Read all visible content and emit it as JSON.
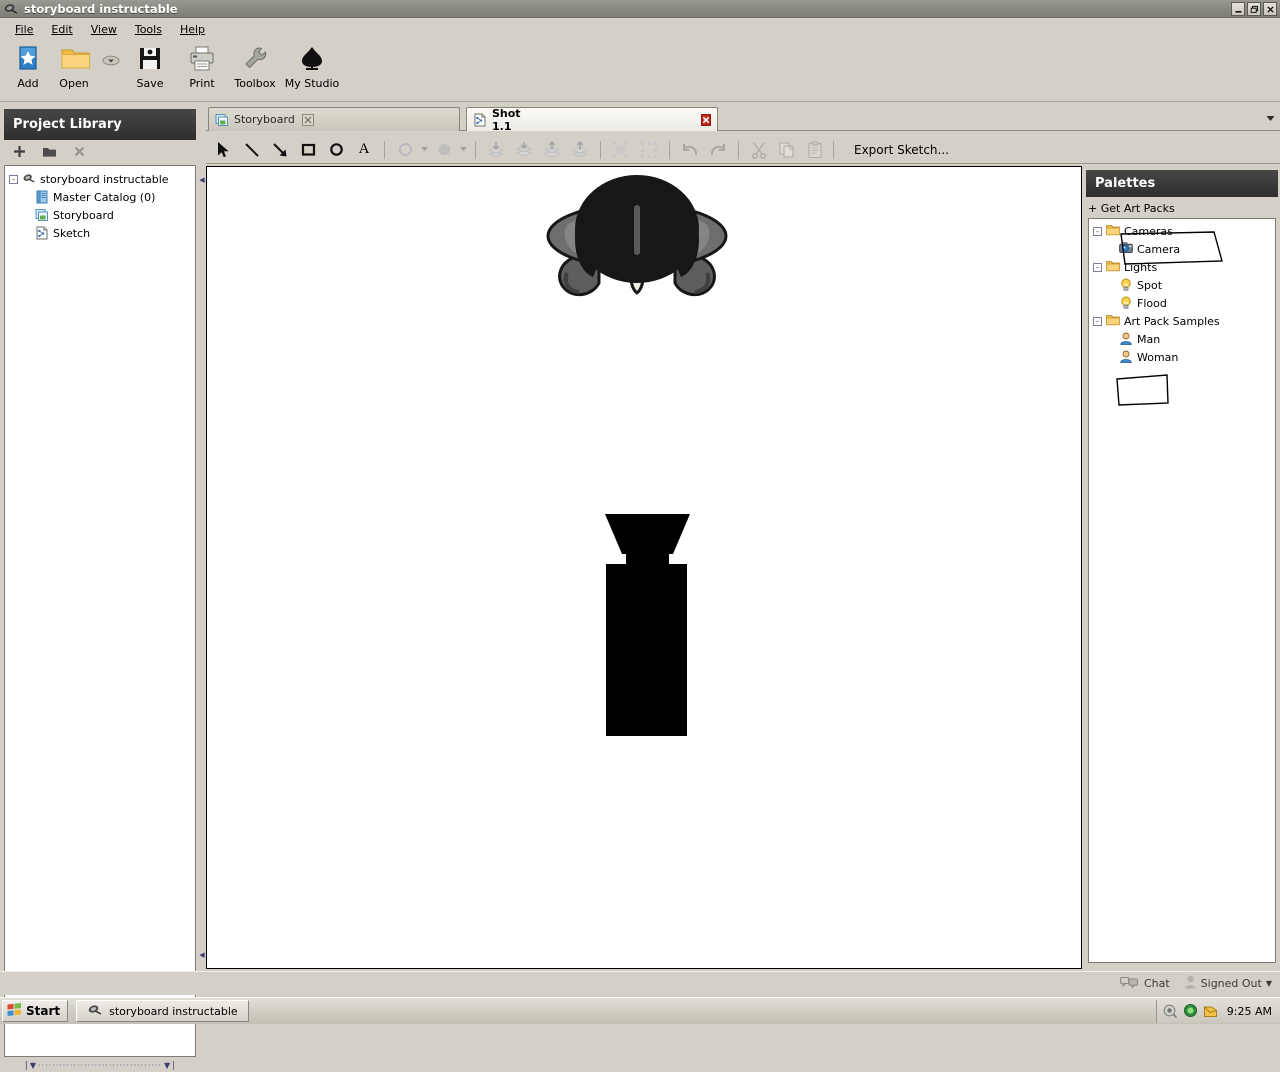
{
  "window": {
    "title": "storyboard instructable",
    "icon": "app-logo-icon",
    "minimize": "_",
    "maximize": "❐",
    "close": "✕"
  },
  "menu": [
    {
      "label": "File",
      "accel": "F"
    },
    {
      "label": "Edit",
      "accel": "E"
    },
    {
      "label": "View",
      "accel": "V"
    },
    {
      "label": "Tools",
      "accel": "T"
    },
    {
      "label": "Help",
      "accel": "H"
    }
  ],
  "toolbar": [
    {
      "label": "Add",
      "icon": "add-star-icon"
    },
    {
      "label": "Open",
      "icon": "open-folder-icon"
    },
    {
      "label": "Save",
      "icon": "save-floppy-icon"
    },
    {
      "label": "Print",
      "icon": "print-icon"
    },
    {
      "label": "Toolbox",
      "icon": "wrench-toolbox-icon"
    },
    {
      "label": "My Studio",
      "icon": "my-studio-icon"
    }
  ],
  "library": {
    "header": "Project Library",
    "tools": [
      {
        "name": "add-item-button",
        "glyph": "＋"
      },
      {
        "name": "new-folder-button",
        "glyph": "▬"
      },
      {
        "name": "delete-item-button",
        "glyph": "✕"
      }
    ],
    "tree": [
      {
        "label": "storyboard instructable",
        "icon": "project-icon",
        "depth": 0,
        "twisty": "-"
      },
      {
        "label": "Master Catalog (0)",
        "icon": "catalog-icon",
        "depth": 1,
        "twisty": ""
      },
      {
        "label": "Storyboard",
        "icon": "storyboard-icon",
        "depth": 1,
        "twisty": ""
      },
      {
        "label": "Sketch",
        "icon": "sketch-icon",
        "depth": 1,
        "twisty": ""
      }
    ]
  },
  "tabs": [
    {
      "label": "Storyboard",
      "icon": "storyboard-icon",
      "active": false,
      "close": "✕"
    },
    {
      "label": "Shot 1.1",
      "icon": "sketch-icon",
      "active": true,
      "close": "✕"
    }
  ],
  "tab_overflow": "▼",
  "doc_toolbar": {
    "tools": [
      {
        "name": "select-arrow-tool",
        "glyph": "➤",
        "enabled": true
      },
      {
        "name": "line-tool",
        "glyph": "╲",
        "enabled": true
      },
      {
        "name": "arrow-tool",
        "glyph": "↘",
        "enabled": true
      },
      {
        "name": "rectangle-tool",
        "glyph": "□",
        "enabled": true
      },
      {
        "name": "ellipse-tool",
        "glyph": "◯",
        "enabled": true
      },
      {
        "name": "text-tool",
        "glyph": "A",
        "enabled": true
      },
      {
        "name": "stroke-color-tool",
        "glyph": "◯",
        "enabled": false
      },
      {
        "name": "fill-color-tool",
        "glyph": "●",
        "enabled": false
      },
      {
        "name": "send-to-back-tool",
        "glyph": "⬇",
        "enabled": false
      },
      {
        "name": "send-backward-tool",
        "glyph": "⬇",
        "enabled": false
      },
      {
        "name": "bring-forward-tool",
        "glyph": "⬆",
        "enabled": false
      },
      {
        "name": "bring-to-front-tool",
        "glyph": "⬆",
        "enabled": false
      },
      {
        "name": "group-tool",
        "glyph": "▣",
        "enabled": false
      },
      {
        "name": "ungroup-tool",
        "glyph": "░",
        "enabled": false
      },
      {
        "name": "undo-tool",
        "glyph": "↶",
        "enabled": false
      },
      {
        "name": "redo-tool",
        "glyph": "↷",
        "enabled": false
      },
      {
        "name": "cut-tool",
        "glyph": "✂",
        "enabled": false
      },
      {
        "name": "copy-tool",
        "glyph": "❐",
        "enabled": false
      },
      {
        "name": "paste-tool",
        "glyph": "Ὄb",
        "enabled": false
      }
    ],
    "export_label": "Export Sketch..."
  },
  "canvas": {
    "objects": [
      {
        "name": "man-figure-topdown",
        "type": "character",
        "label": "Man (top view)"
      },
      {
        "name": "camera-figure-topdown",
        "type": "camera",
        "label": "Camera (top view)"
      }
    ]
  },
  "palettes": {
    "header": "Palettes",
    "get_art_packs": "+ Get Art Packs",
    "tree": [
      {
        "label": "Cameras",
        "icon": "folder-icon",
        "depth": 0,
        "twisty": "-",
        "annotated": false
      },
      {
        "label": "Camera",
        "icon": "camera-icon",
        "depth": 1,
        "twisty": "",
        "annotated": true
      },
      {
        "label": "Lights",
        "icon": "folder-icon",
        "depth": 0,
        "twisty": "-",
        "annotated": false
      },
      {
        "label": "Spot",
        "icon": "lightbulb-icon",
        "depth": 1,
        "twisty": "",
        "annotated": false
      },
      {
        "label": "Flood",
        "icon": "lightbulb-icon",
        "depth": 1,
        "twisty": "",
        "annotated": false
      },
      {
        "label": "Art Pack Samples",
        "icon": "folder-icon",
        "depth": 0,
        "twisty": "-",
        "annotated": false
      },
      {
        "label": "Man",
        "icon": "person-icon",
        "depth": 1,
        "twisty": "",
        "annotated": true
      },
      {
        "label": "Woman",
        "icon": "person-icon",
        "depth": 1,
        "twisty": "",
        "annotated": false
      }
    ]
  },
  "status": {
    "chat": "Chat",
    "chat_icon": "chat-bubbles-icon",
    "account": "Signed Out",
    "account_icon": "user-icon",
    "account_caret": "▾"
  },
  "taskbar": {
    "start": "Start",
    "task": "storyboard instructable",
    "clock": "9:25 AM",
    "tray": [
      "volume-icon",
      "network-icon",
      "update-icon"
    ]
  },
  "colors": {
    "chrome": "#d4d0c8",
    "panel_header": "#2e2e2e",
    "canvas": "#ffffff",
    "tab_active": "#fbfaf7",
    "close_red": "#c62b20",
    "folder": "#f5c251",
    "hair": "#171717",
    "shoulder": "#6e6e6e"
  }
}
